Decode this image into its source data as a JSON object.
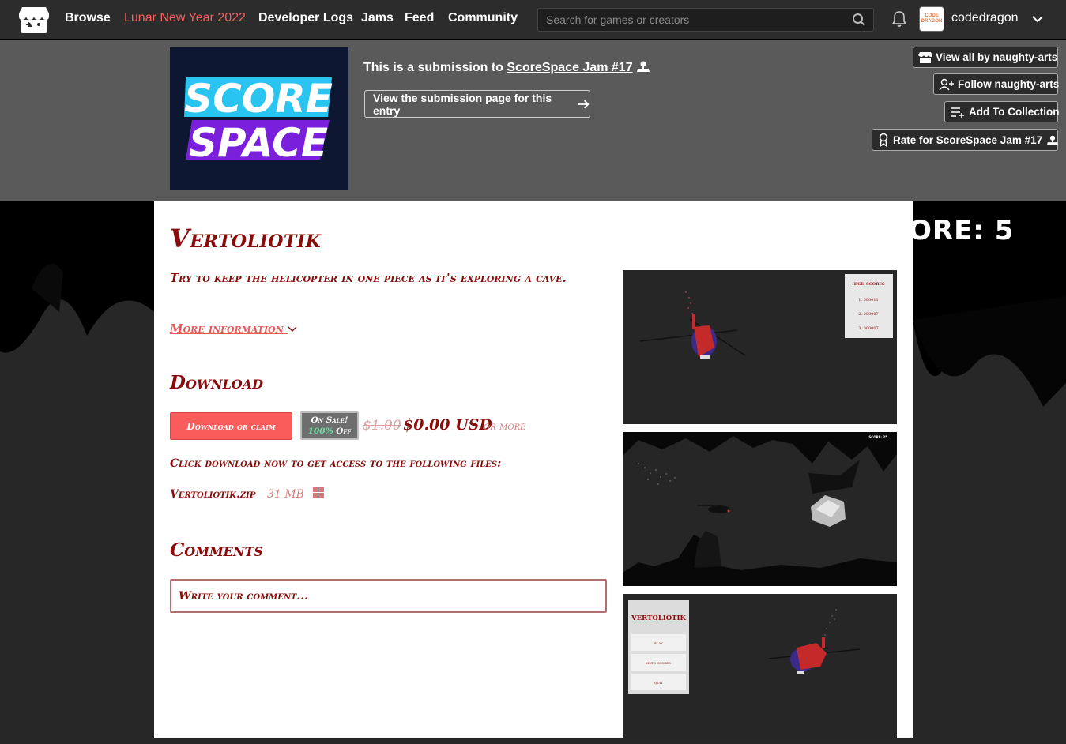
{
  "nav": {
    "links": [
      "Browse",
      "Lunar New Year 2022",
      "Developer Logs",
      "Jams",
      "Feed",
      "Community"
    ],
    "search_placeholder": "Search for games or creators",
    "username": "codedragon",
    "avatar_text": "CODE DRAGON"
  },
  "jam": {
    "logo_line1": "SCORE",
    "logo_line2": "SPACE",
    "submission_prefix": "This is a submission to",
    "jam_name": "ScoreSpace Jam #17",
    "submission_page_label": "View the submission page for this entry"
  },
  "actions": {
    "view_all": "View all by naughty-arts",
    "follow": "Follow naughty-arts",
    "add_collection": "Add To Collection",
    "rate": "Rate for ScoreSpace Jam #17"
  },
  "background_score": "ORE: 5",
  "game": {
    "title": "Vertoliotik",
    "description": "Try to keep the helicopter in one piece as it's exploring a cave.",
    "more_info": "More information"
  },
  "download": {
    "heading": "Download",
    "button": "Download or claim",
    "sale_line1": "On Sale!",
    "sale_pct": "100%",
    "sale_off": "Off",
    "old_price": "$1.00",
    "new_price": "$0.00 USD",
    "or_more": "or more",
    "click_text": "Click download now to get access to the following files:",
    "file_name": "Vertoliotik.zip",
    "file_size": "31 MB"
  },
  "comments": {
    "heading": "Comments",
    "placeholder": "Write your comment..."
  },
  "screenshots": {
    "shot1": {
      "hs_title": "HIGH SCORES",
      "hs_entries": [
        "1. 000011",
        "2. 000007",
        "3. 000007"
      ]
    },
    "shot2": {
      "score": "SCORE: 25"
    },
    "shot3": {
      "menu_title": "VERTOLIOTIK",
      "buttons": [
        "PLAY",
        "HIGH SCORES",
        "QUIT"
      ]
    }
  },
  "colors": {
    "accent": "#fa5c5c",
    "title": "#8a0b0b",
    "nav_hot": "#fa5c5c"
  }
}
